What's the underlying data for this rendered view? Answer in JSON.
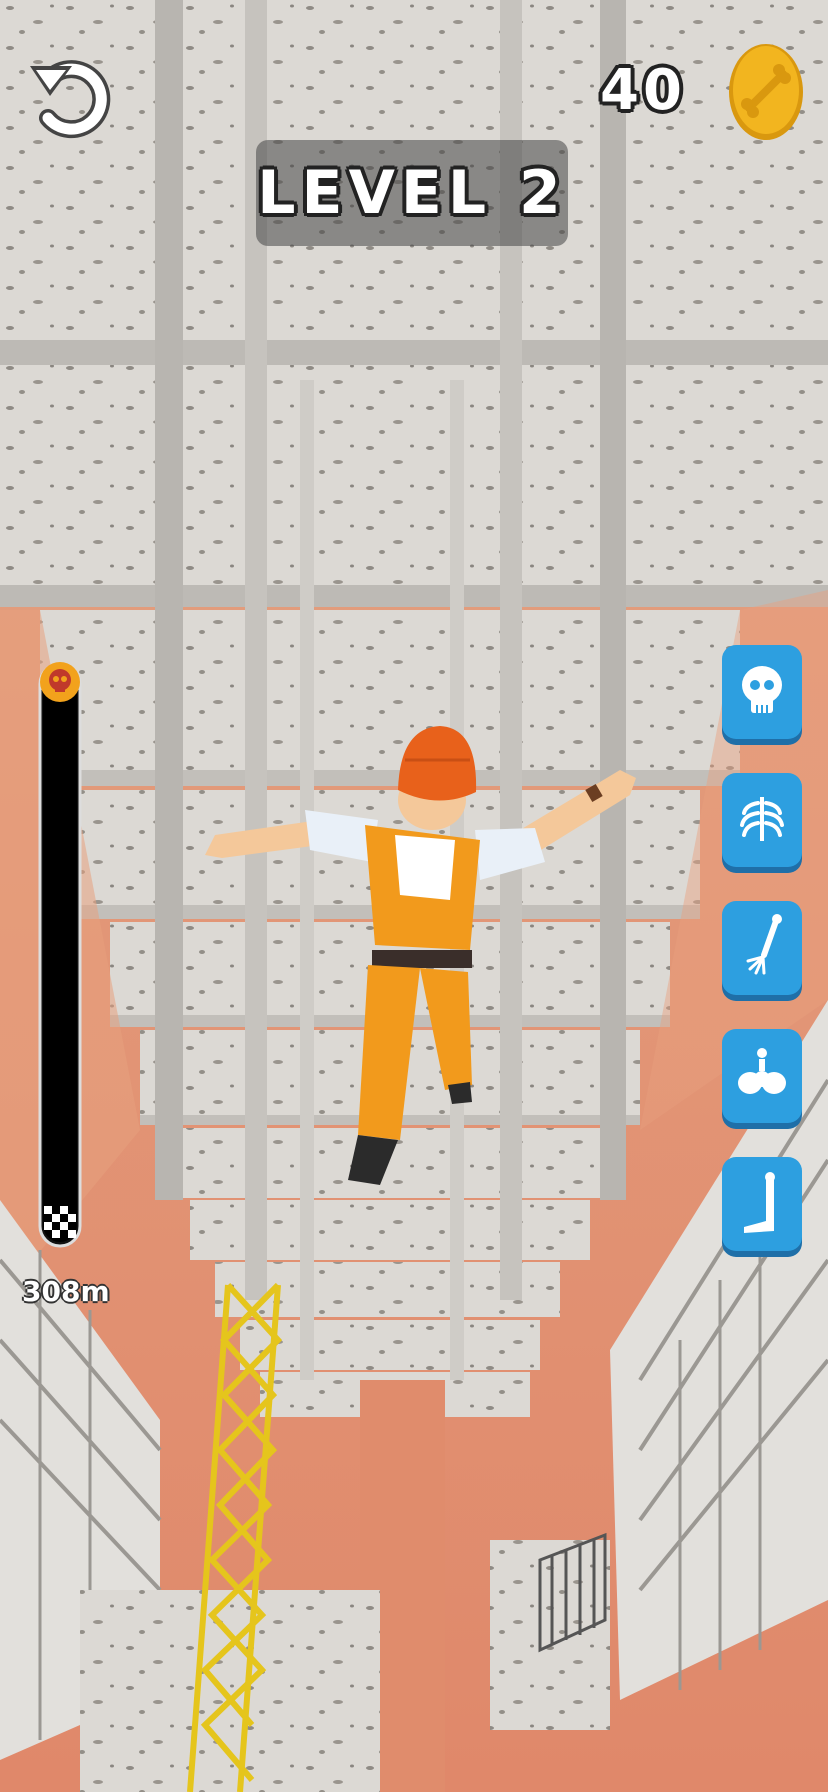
{
  "hud": {
    "coins": "40",
    "level": "LEVEL 2",
    "distance": "308m"
  },
  "progress": {
    "fill_fraction": 1.0
  },
  "bone_buttons": [
    {
      "icon": "skull-icon"
    },
    {
      "icon": "ribcage-icon"
    },
    {
      "icon": "arm-bone-icon"
    },
    {
      "icon": "pelvis-icon"
    },
    {
      "icon": "leg-bone-icon"
    }
  ],
  "colors": {
    "sky": "#e89b74",
    "concrete": "#d9d6d1",
    "beam": "#c9c7c3",
    "worker_orange": "#f29a1c",
    "helmet": "#e8611b",
    "button_blue": "#2d9fe0",
    "coin_gold": "#f2b51f",
    "crane_yellow": "#f3dd2b"
  }
}
